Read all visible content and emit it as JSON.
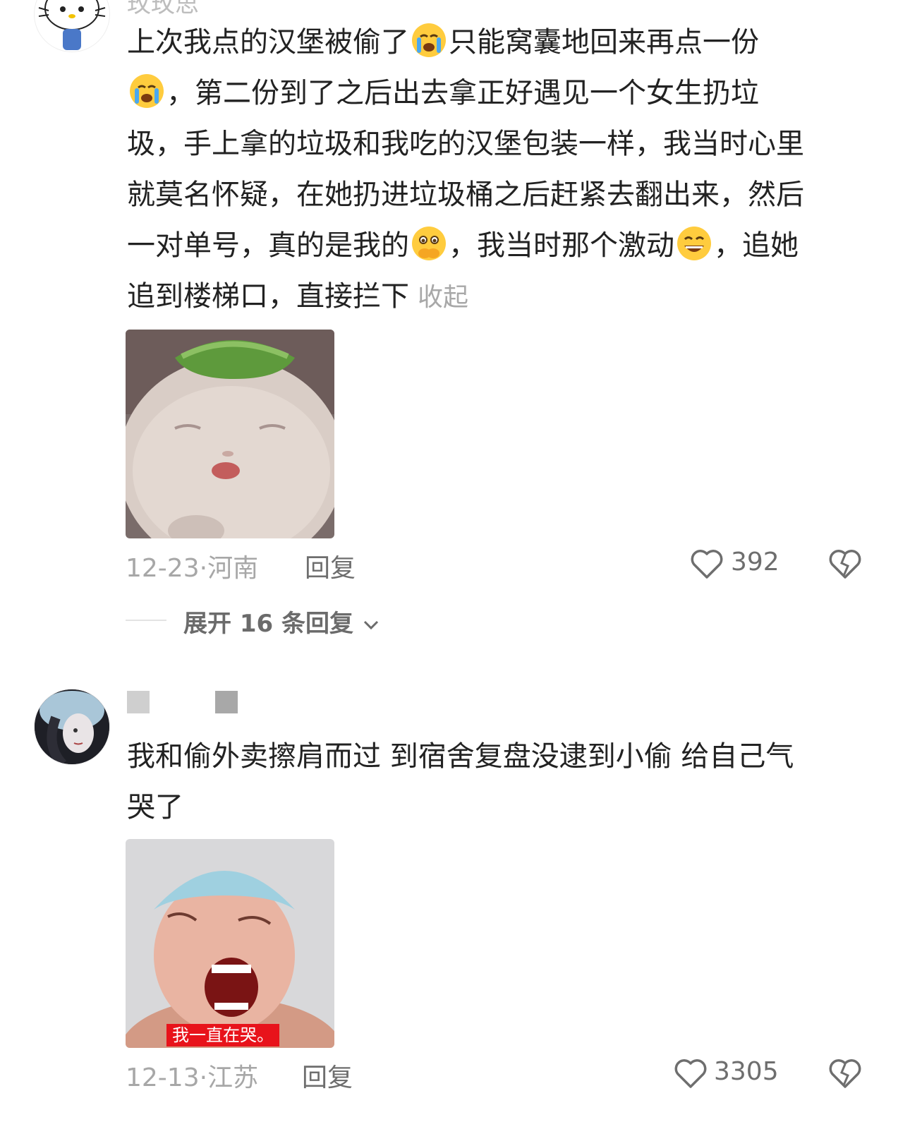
{
  "comment1": {
    "username_fragment": "玫玫思",
    "lines": [
      "上次我点的汉堡被偷了",
      "只能窝囊地回来再点一份",
      "，第二份到了之后出去拿正好遇见一个女生扔垃",
      "圾，手上拿的垃圾和我吃的汉堡包装一样，我当时心里",
      "就莫名怀疑，在她扔进垃圾桶之后赶紧去翻出来，然后",
      "一对单号，真的是我的",
      "，我当时那个激动",
      "，追她",
      "追到楼梯口，直接拦下"
    ],
    "collapse_label": "收起",
    "date": "12-23",
    "location": "河南",
    "reply_label": "回复",
    "likes": "392",
    "expand_label": "展开 16 条回复"
  },
  "comment2": {
    "lines": [
      "我和偷外卖擦肩而过 到宿舍复盘没逮到小偷 给自己气",
      "哭了"
    ],
    "sticker_caption": "我一直在哭。",
    "date": "12-13",
    "location": "江苏",
    "reply_label": "回复",
    "likes": "3305"
  },
  "colors": {
    "text": "#222222",
    "meta_gray": "#a7a7a7",
    "caption_red": "#e8131b"
  }
}
